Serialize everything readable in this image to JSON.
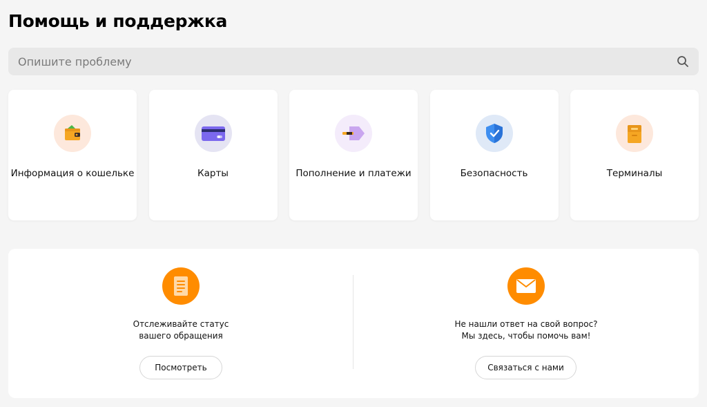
{
  "header": {
    "title": "Помощь и поддержка"
  },
  "search": {
    "placeholder": "Опишите проблему",
    "value": ""
  },
  "categories": [
    {
      "label": "Информация о кошельке",
      "icon": "wallet-icon"
    },
    {
      "label": "Карты",
      "icon": "card-icon"
    },
    {
      "label": "Пополнение и платежи",
      "icon": "payment-tag-icon"
    },
    {
      "label": "Безопасность",
      "icon": "shield-icon"
    },
    {
      "label": "Терминалы",
      "icon": "terminal-icon"
    }
  ],
  "support": {
    "track": {
      "line1": "Отслеживайте статус",
      "line2": "вашего обращения",
      "button": "Посмотреть",
      "icon": "document-icon"
    },
    "contact": {
      "line1": "Не нашли ответ на свой вопрос?",
      "line2": "Мы здесь, чтобы помочь вам!",
      "button": "Связаться с нами",
      "icon": "envelope-icon"
    }
  },
  "colors": {
    "accent": "#ff8c00",
    "background": "#f5f5f5",
    "card": "#ffffff"
  }
}
